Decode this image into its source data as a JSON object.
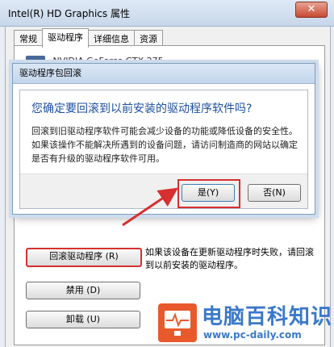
{
  "window": {
    "title": "Intel(R) HD Graphics 属性",
    "close_glyph": "✕"
  },
  "tabs": [
    "常规",
    "驱动程序",
    "详细信息",
    "资源"
  ],
  "device": {
    "name": "NVIDIA GeForce GTX 275"
  },
  "dialog": {
    "title": "驱动程序包回滚",
    "question": "您确定要回滚到以前安装的驱动程序软件吗?",
    "explanation": "回滚到旧驱动程序软件可能会减少设备的功能或降低设备的安全性。如果该操作不能解决所遇到的设备问题，请访问制造商的网站以确定是否有升级的驱动程序软件可用。",
    "yes_label": "是(Y)",
    "no_label": "否(N)"
  },
  "buttons": {
    "rollback": "回滚驱动程序 (R)",
    "rollback_desc": "如果该设备在更新驱动程序时失败，请回滚到以前安装的驱动程序。",
    "disable": "禁用 (D)",
    "uninstall": "卸载 (U)"
  },
  "watermark": {
    "title": "电脑百科知识",
    "url": "www.pc-daily.com"
  },
  "colors": {
    "highlight": "#d63030",
    "watermark": "#3a78c9",
    "logo": "#e85a2c"
  }
}
